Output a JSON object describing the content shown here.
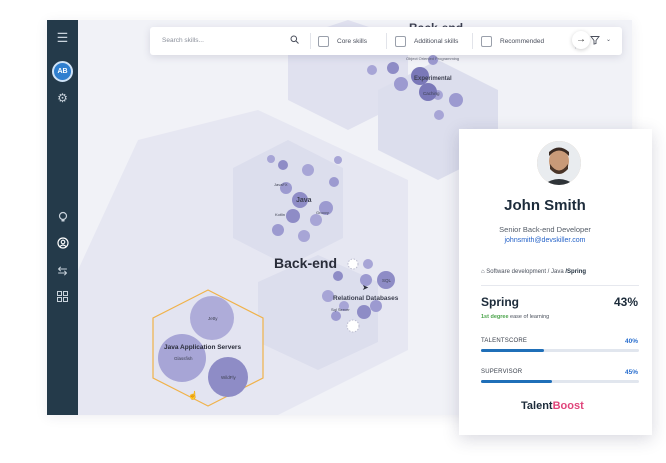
{
  "sidebar": {
    "avatar_initials": "AB",
    "icons": [
      "menu-icon",
      "settings-icon",
      "lightbulb-icon",
      "user-icon",
      "swap-icon",
      "grid-icon"
    ]
  },
  "topbar": {
    "search_placeholder": "Search skills...",
    "filters": [
      {
        "label": "Core skills"
      },
      {
        "label": "Additional skills"
      },
      {
        "label": "Recommended"
      }
    ]
  },
  "map": {
    "labels": {
      "backend_top": "Back-end",
      "experimental": "Experimental",
      "object_oriented": "Object Oriented Programming",
      "caching": "Caching",
      "java": "Java",
      "javafx": "JavaFX",
      "kotlin": "Kotlin",
      "groovy": "Groovy",
      "backend": "Back-end",
      "relational_databases": "Relational Databases",
      "sql": "SQL",
      "sql_server": "Sql Server",
      "java_app_servers": "Java Application Servers",
      "jetty": "Jetty",
      "glassfish": "Glassfish",
      "wildfly": "WildFly"
    }
  },
  "profile": {
    "name": "John Smith",
    "role": "Senior Back-end Developer",
    "email": "johnsmith@devskiller.com",
    "breadcrumb": {
      "part1": "Software development",
      "sep": "/",
      "part2": "Java",
      "current": "Spring"
    },
    "skill": "Spring",
    "skill_pct": "43%",
    "ease_degree": "1st degree",
    "ease_text": "ease of learning",
    "metrics": [
      {
        "label": "TALENTSCORE",
        "value": "40%",
        "fraction": 0.4
      },
      {
        "label": "SUPERVISOR",
        "value": "45%",
        "fraction": 0.45
      }
    ],
    "brand_main": "Talent",
    "brand_accent": "Boost"
  },
  "colors": {
    "sidebar": "#243a4a",
    "accent": "#2f7fcf",
    "bubble": "#8e8cc6",
    "bubble_dark": "#7a78b8",
    "selection": "#f0b24a"
  }
}
